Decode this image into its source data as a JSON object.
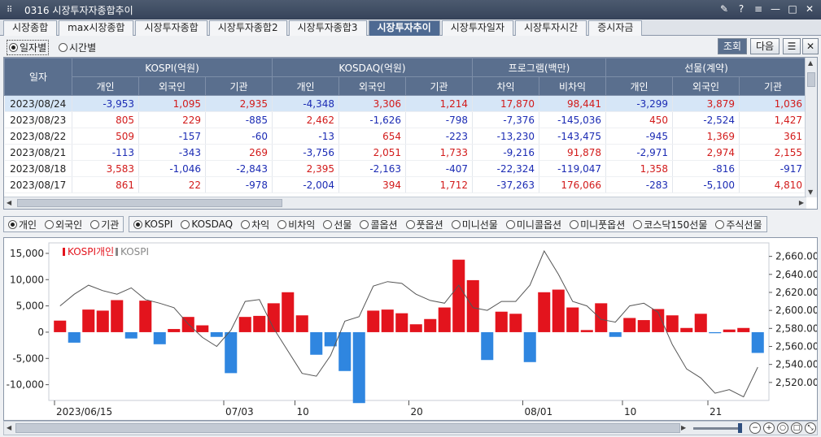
{
  "window": {
    "title": "0316 시장투자자종합추이"
  },
  "tabs": [
    "시장종합",
    "max시장종합",
    "시장투자종합",
    "시장투자종합2",
    "시장투자종합3",
    "시장투자추이",
    "시장투자일자",
    "시장투자시간",
    "증시자금"
  ],
  "active_tab": 5,
  "options": {
    "daily": "일자별",
    "hourly": "시간별",
    "lookup": "조회",
    "next": "다음"
  },
  "table": {
    "date_header": "일자",
    "groups": [
      "KOSPI(억원)",
      "KOSDAQ(억원)",
      "프로그램(백만)",
      "선물(계약)"
    ],
    "subheaders": [
      "개인",
      "외국인",
      "기관",
      "개인",
      "외국인",
      "기관",
      "차익",
      "비차익",
      "개인",
      "외국인",
      "기관"
    ],
    "rows": [
      [
        "2023/08/24",
        "-3,953",
        "1,095",
        "2,935",
        "-4,348",
        "3,306",
        "1,214",
        "17,870",
        "98,441",
        "-3,299",
        "3,879",
        "1,036"
      ],
      [
        "2023/08/23",
        "805",
        "229",
        "-885",
        "2,462",
        "-1,626",
        "-798",
        "-7,376",
        "-145,036",
        "450",
        "-2,524",
        "1,427"
      ],
      [
        "2023/08/22",
        "509",
        "-157",
        "-60",
        "-13",
        "654",
        "-223",
        "-13,230",
        "-143,475",
        "-945",
        "1,369",
        "361"
      ],
      [
        "2023/08/21",
        "-113",
        "-343",
        "269",
        "-3,756",
        "2,051",
        "1,733",
        "-9,216",
        "91,878",
        "-2,971",
        "2,974",
        "2,155"
      ],
      [
        "2023/08/18",
        "3,583",
        "-1,046",
        "-2,843",
        "2,395",
        "-2,163",
        "-407",
        "-22,324",
        "-119,047",
        "1,358",
        "-816",
        "-917"
      ],
      [
        "2023/08/17",
        "861",
        "22",
        "-978",
        "-2,004",
        "394",
        "1,712",
        "-37,263",
        "176,066",
        "-283",
        "-5,100",
        "4,810"
      ]
    ]
  },
  "chart_controls": {
    "investors": [
      "개인",
      "외국인",
      "기관"
    ],
    "markets": [
      "KOSPI",
      "KOSDAQ",
      "차익",
      "비차익",
      "선물",
      "콜옵션",
      "풋옵션",
      "미니선물",
      "미니콜옵션",
      "미니풋옵션",
      "코스닥150선물",
      "주식선물"
    ]
  },
  "colors": {
    "pos_bar": "#e3141d",
    "neg_bar": "#2f86e0",
    "line": "#555555"
  },
  "chart_data": {
    "type": "bar",
    "series": [
      {
        "name": "KOSPI개인",
        "kind": "bar",
        "values": [
          2200,
          -2000,
          4300,
          4100,
          6100,
          -1200,
          6000,
          -2300,
          600,
          2900,
          1300,
          -900,
          -7800,
          2900,
          3100,
          5500,
          7600,
          3200,
          -4300,
          -2700,
          -7400,
          -13500,
          4100,
          4300,
          3600,
          1500,
          2500,
          4700,
          13800,
          9900,
          -5300,
          3900,
          3500,
          -5700,
          7600,
          8100,
          4700,
          400,
          5500,
          -900,
          2700,
          2300,
          4400,
          3200,
          800,
          3500,
          -200,
          500,
          800,
          -3953
        ]
      },
      {
        "name": "KOSPI",
        "kind": "line",
        "axis": "right",
        "values": [
          2605,
          2618,
          2628,
          2622,
          2618,
          2625,
          2612,
          2608,
          2603,
          2585,
          2570,
          2560,
          2578,
          2610,
          2612,
          2580,
          2555,
          2530,
          2527,
          2550,
          2588,
          2593,
          2627,
          2632,
          2630,
          2618,
          2611,
          2608,
          2628,
          2603,
          2600,
          2610,
          2610,
          2628,
          2666,
          2640,
          2610,
          2605,
          2590,
          2587,
          2605,
          2608,
          2598,
          2562,
          2535,
          2525,
          2508,
          2512,
          2504,
          2537
        ]
      }
    ],
    "x_ticks": [
      "2023/06/15",
      "07/03",
      "10",
      "20",
      "08/01",
      "10",
      "21"
    ],
    "ylim_left": [
      -13000,
      17000
    ],
    "yticks_left": [
      "15,000",
      "10,000",
      "5,000",
      "0",
      "-5,000",
      "-10,000"
    ],
    "ylim_right": [
      2500,
      2675
    ],
    "yticks_right": [
      "2,660.00",
      "2,640.00",
      "2,620.00",
      "2,600.00",
      "2,580.00",
      "2,560.00",
      "2,540.00",
      "2,520.00"
    ],
    "legend": [
      "KOSPI개인",
      "KOSPI"
    ]
  }
}
